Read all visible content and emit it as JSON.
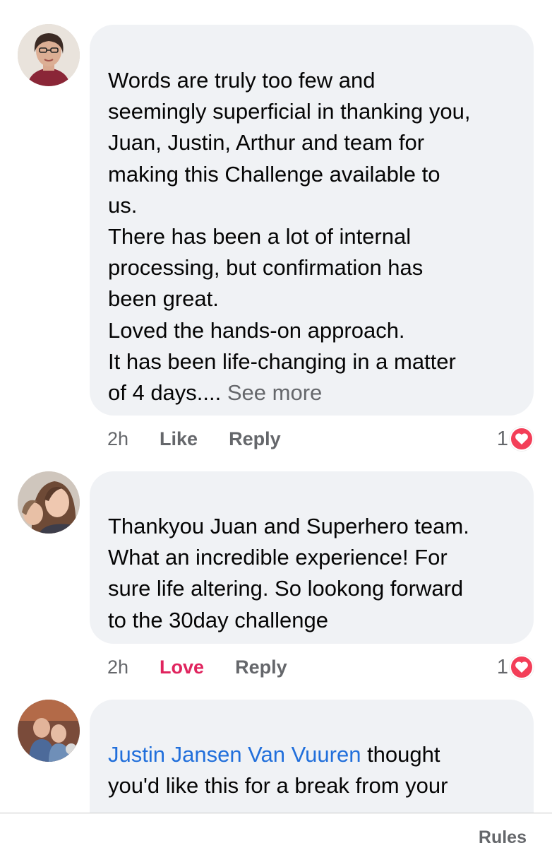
{
  "comments": [
    {
      "lines": [
        "Words are truly too few and",
        "seemingly superficial in thanking you,",
        "Juan, Justin, Arthur and team for",
        "making this Challenge available to",
        "us.",
        "There has been a lot of internal",
        "processing, but confirmation has",
        "been great.",
        "Loved the hands-on approach.",
        "It has been life-changing in a matter"
      ],
      "last_line": "of 4 days.... ",
      "see_more": "See more",
      "time": "2h",
      "like_label": "Like",
      "reply_label": "Reply",
      "reaction_count": "1",
      "reaction_icon": "heart-icon"
    },
    {
      "lines": [
        "Thankyou Juan and Superhero team.",
        "What an incredible experience! For",
        "sure life altering. So lookong forward",
        "to the 30day challenge"
      ],
      "time": "2h",
      "love_label": "Love",
      "reply_label": "Reply",
      "reaction_count": "1",
      "reaction_icon": "heart-icon"
    },
    {
      "mention": "Justin Jansen Van Vuuren",
      "line1_rest": " thought",
      "line2": "you'd like this for a break from your"
    }
  ],
  "footer": {
    "rules_label": "Rules"
  },
  "colors": {
    "link": "#216fdb",
    "love": "#e0245e",
    "heart": "#f33e58",
    "bubble": "#f0f2f5"
  }
}
